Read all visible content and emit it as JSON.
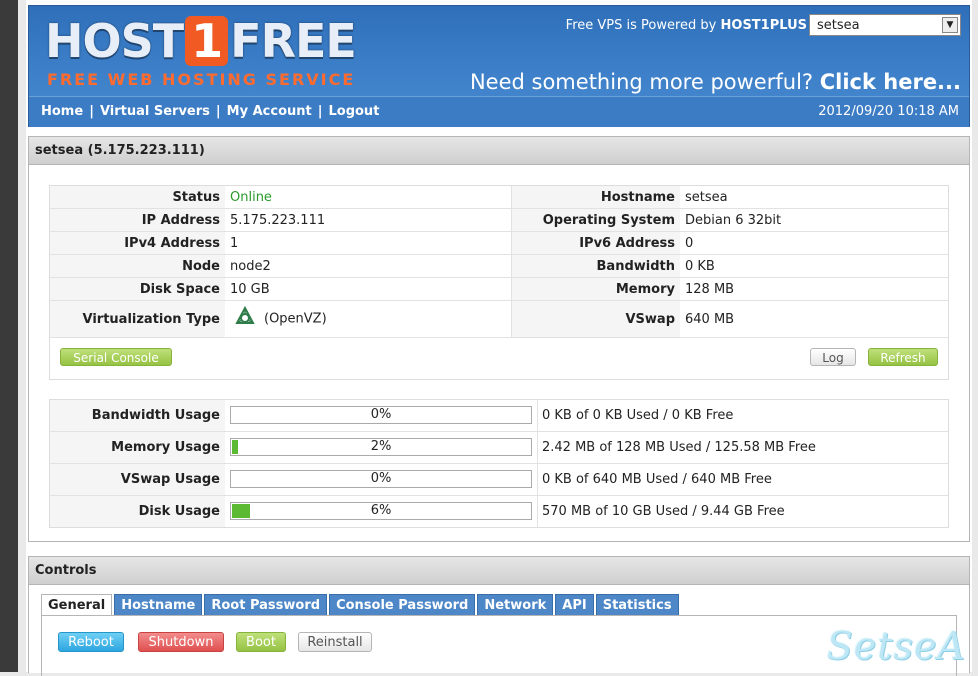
{
  "header": {
    "logo_host": "HOST",
    "logo_one": "1",
    "logo_free": "FREE",
    "logo_tagline": "FREE WEB HOSTING SERVICE",
    "powered_prefix": "Free VPS is Powered by",
    "powered_brand": "HOST1PLUS",
    "server_select_value": "setsea",
    "promo_text": "Need something more powerful?",
    "promo_link": "Click here...",
    "datetime": "2012/09/20 10:18 AM"
  },
  "nav": {
    "items": [
      {
        "label": "Home"
      },
      {
        "label": "Virtual Servers"
      },
      {
        "label": "My Account"
      },
      {
        "label": "Logout"
      }
    ],
    "separator": "|"
  },
  "server_panel": {
    "title": "setsea (5.175.223.111)",
    "rows": [
      {
        "l_label": "Status",
        "l_value": "Online",
        "r_label": "Hostname",
        "r_value": "setsea"
      },
      {
        "l_label": "IP Address",
        "l_value": "5.175.223.111",
        "r_label": "Operating System",
        "r_value": "Debian 6 32bit"
      },
      {
        "l_label": "IPv4 Address",
        "l_value": "1",
        "r_label": "IPv6 Address",
        "r_value": "0"
      },
      {
        "l_label": "Node",
        "l_value": "node2",
        "r_label": "Bandwidth",
        "r_value": "0 KB"
      },
      {
        "l_label": "Disk Space",
        "l_value": "10 GB",
        "r_label": "Memory",
        "r_value": "128 MB"
      },
      {
        "l_label": "Virtualization Type",
        "l_value": "(OpenVZ)",
        "r_label": "VSwap",
        "r_value": "640 MB"
      }
    ],
    "status_color": "#2a9a2a",
    "virt_icon": "openvz-icon",
    "buttons": {
      "serial_console": "Serial Console",
      "log": "Log",
      "refresh": "Refresh"
    },
    "usage": [
      {
        "label": "Bandwidth Usage",
        "percent_text": "0%",
        "fraction": 0.0,
        "detail": "0 KB of 0 KB Used / 0 KB Free"
      },
      {
        "label": "Memory Usage",
        "percent_text": "2%",
        "fraction": 0.02,
        "detail": "2.42 MB of 128 MB Used / 125.58 MB Free"
      },
      {
        "label": "VSwap Usage",
        "percent_text": "0%",
        "fraction": 0.0,
        "detail": "0 KB of 640 MB Used / 640 MB Free"
      },
      {
        "label": "Disk Usage",
        "percent_text": "6%",
        "fraction": 0.06,
        "detail": "570 MB of 10 GB Used / 9.44 GB Free"
      }
    ]
  },
  "controls": {
    "title": "Controls",
    "tabs": [
      {
        "label": "General",
        "active": true
      },
      {
        "label": "Hostname"
      },
      {
        "label": "Root Password"
      },
      {
        "label": "Console Password"
      },
      {
        "label": "Network"
      },
      {
        "label": "API"
      },
      {
        "label": "Statistics"
      }
    ],
    "buttons": {
      "reboot": "Reboot",
      "shutdown": "Shutdown",
      "boot": "Boot",
      "reinstall": "Reinstall"
    }
  },
  "watermark": "SetseA",
  "colors": {
    "header_blue": "#3c7cc4",
    "logo_orange": "#f15a22",
    "bar_green": "#5cb932",
    "tab_blue": "#4d87c7"
  }
}
